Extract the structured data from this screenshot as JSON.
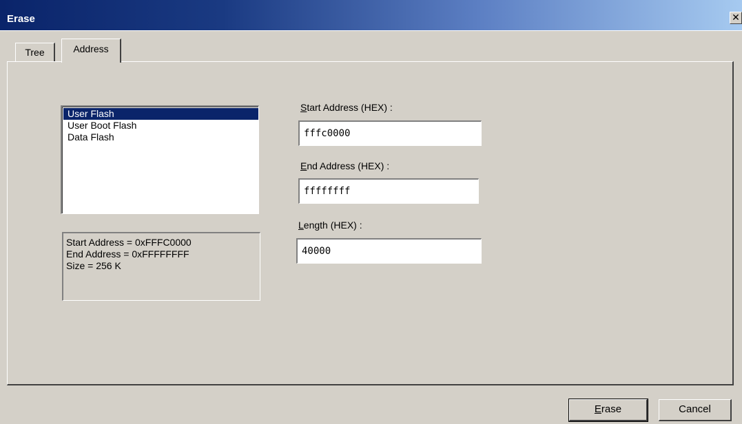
{
  "window": {
    "title": "Erase",
    "close_glyph": "✕"
  },
  "tabs": [
    {
      "label": "Tree",
      "active": false
    },
    {
      "label": "Address",
      "active": true
    }
  ],
  "area_list": {
    "items": [
      "User Flash",
      "User Boot Flash",
      "Data Flash"
    ],
    "selected_index": 0
  },
  "info": {
    "lines": [
      "Start Address = 0xFFFC0000",
      "End Address = 0xFFFFFFFF",
      "Size = 256 K"
    ]
  },
  "fields": {
    "start": {
      "label_mnemonic": "S",
      "label_rest": "tart Address (HEX) :",
      "value": "fffc0000"
    },
    "end": {
      "label_mnemonic": "E",
      "label_rest": "nd Address (HEX) :",
      "value": "ffffffff"
    },
    "length": {
      "label_mnemonic": "L",
      "label_rest": "ength (HEX) :",
      "value": "40000"
    }
  },
  "buttons": {
    "erase": {
      "mnemonic": "E",
      "rest": "rase"
    },
    "cancel": {
      "label": "Cancel"
    }
  },
  "colors": {
    "dialog_face": "#d4d0c8",
    "selection": "#0a246a",
    "title_gradient_start": "#0a246a",
    "title_gradient_end": "#a6caf0"
  }
}
